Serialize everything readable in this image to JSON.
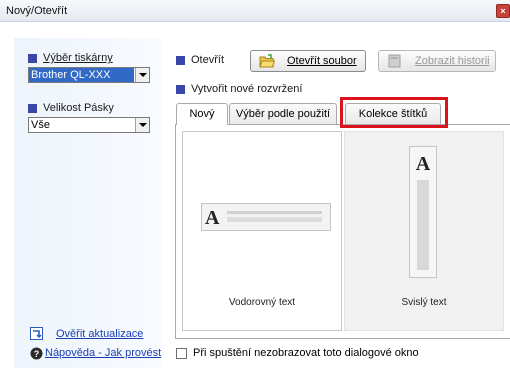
{
  "window": {
    "title": "Nový/Otevřít"
  },
  "left_panel": {
    "printer_label": "Výběr tiskárny",
    "printer_value": "Brother QL-XXX",
    "tape_label": "Velikost Pásky",
    "tape_value": "Vše",
    "update_link": "Ověřit aktualizace",
    "help_link": "Nápověda - Jak provést"
  },
  "open": {
    "label": "Otevřít",
    "open_file_button": "Otevřít soubor",
    "history_button": "Zobrazit historii"
  },
  "new_layout": {
    "label": "Vytvořit nové rozvržení"
  },
  "tabs": [
    {
      "label": "Nový"
    },
    {
      "label": "Výběr podle použití"
    },
    {
      "label": "Kolekce štítků"
    }
  ],
  "cards": [
    {
      "caption": "Vodorovný text",
      "glyph": "A"
    },
    {
      "caption": "Svislý text",
      "glyph": "A"
    }
  ],
  "footer": {
    "checkbox_label": "Při spuštění nezobrazovat toto dialogové okno",
    "checked": false
  },
  "colors": {
    "accent_square": "#3a47a8",
    "link": "#1b3fb3",
    "highlight": "#d9141c"
  }
}
